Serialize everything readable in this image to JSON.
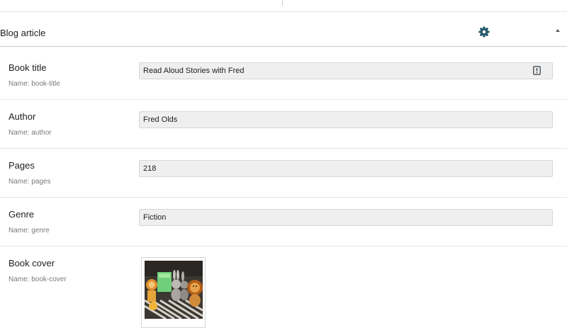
{
  "panel": {
    "title": "Blog article",
    "settings_icon": "gear-icon",
    "collapse_icon": "triangle-up-icon",
    "accent_color": "#23566a"
  },
  "fields": [
    {
      "label": "Book title",
      "name_text": "Name: book-title",
      "value": "Read Aloud Stories with Fred",
      "icon": "field-info-icon"
    },
    {
      "label": "Author",
      "name_text": "Name: author",
      "value": "Fred Olds"
    },
    {
      "label": "Pages",
      "name_text": "Name: pages",
      "value": "218"
    },
    {
      "label": "Genre",
      "name_text": "Name: genre",
      "value": "Fiction"
    },
    {
      "label": "Book cover",
      "name_text": "Name: book-cover",
      "image": "book-cover-thumbnail"
    }
  ]
}
